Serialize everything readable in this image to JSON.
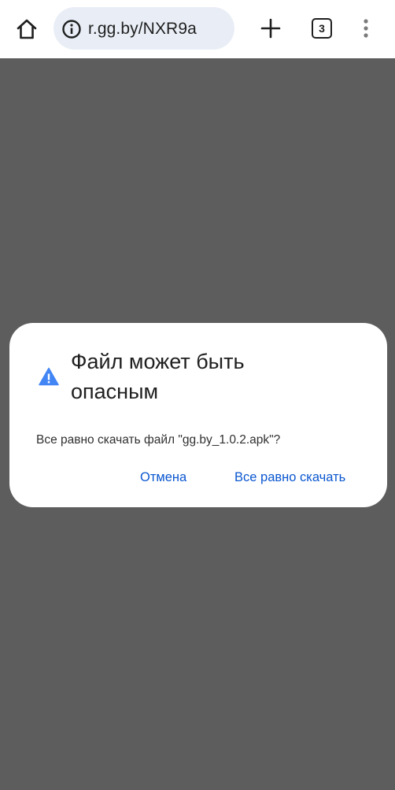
{
  "toolbar": {
    "home_icon": "home-icon",
    "url": "r.gg.by/NXR9a",
    "site_info_icon": "info-icon",
    "new_tab_icon": "plus-icon",
    "tab_count": "3",
    "menu_icon": "more-vert-icon"
  },
  "dialog": {
    "icon": "warning-icon",
    "title": "Файл может быть опасным",
    "message": "Все равно скачать файл \"gg.by_1.0.2.apk\"?",
    "cancel_label": "Отмена",
    "confirm_label": "Все равно скачать"
  },
  "colors": {
    "page_background": "#5d5d5d",
    "omnibox_background": "#e9eef6",
    "accent_blue": "#0b57d0",
    "warning_icon_blue": "#4285f4"
  }
}
